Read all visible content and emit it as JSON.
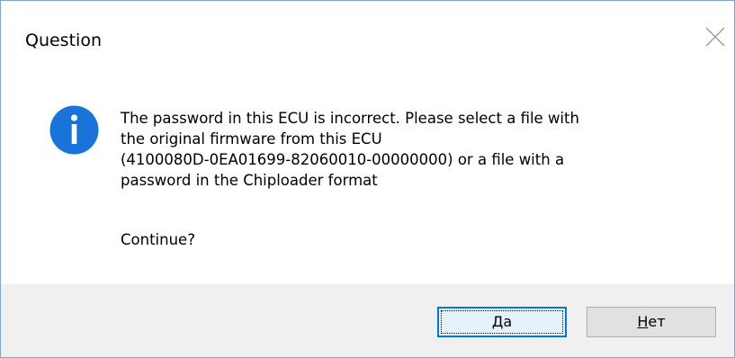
{
  "dialog": {
    "title": "Question",
    "message": "The password in this ECU is incorrect. Please select a file with\nthe original firmware from this ECU\n(4100080D-0EA01699-82060010-00000000) or a file with a\npassword in the Chiploader format",
    "prompt": "Continue?",
    "icon": "info-icon",
    "icon_color": "#1a73d9"
  },
  "buttons": {
    "yes": {
      "mnemonic": "Д",
      "rest": "а"
    },
    "no": {
      "mnemonic": "Н",
      "rest": "ет"
    }
  },
  "colors": {
    "footer_bg": "#f0f0f0",
    "focus_border": "#0078d7",
    "window_border": "#7fa7d4"
  }
}
